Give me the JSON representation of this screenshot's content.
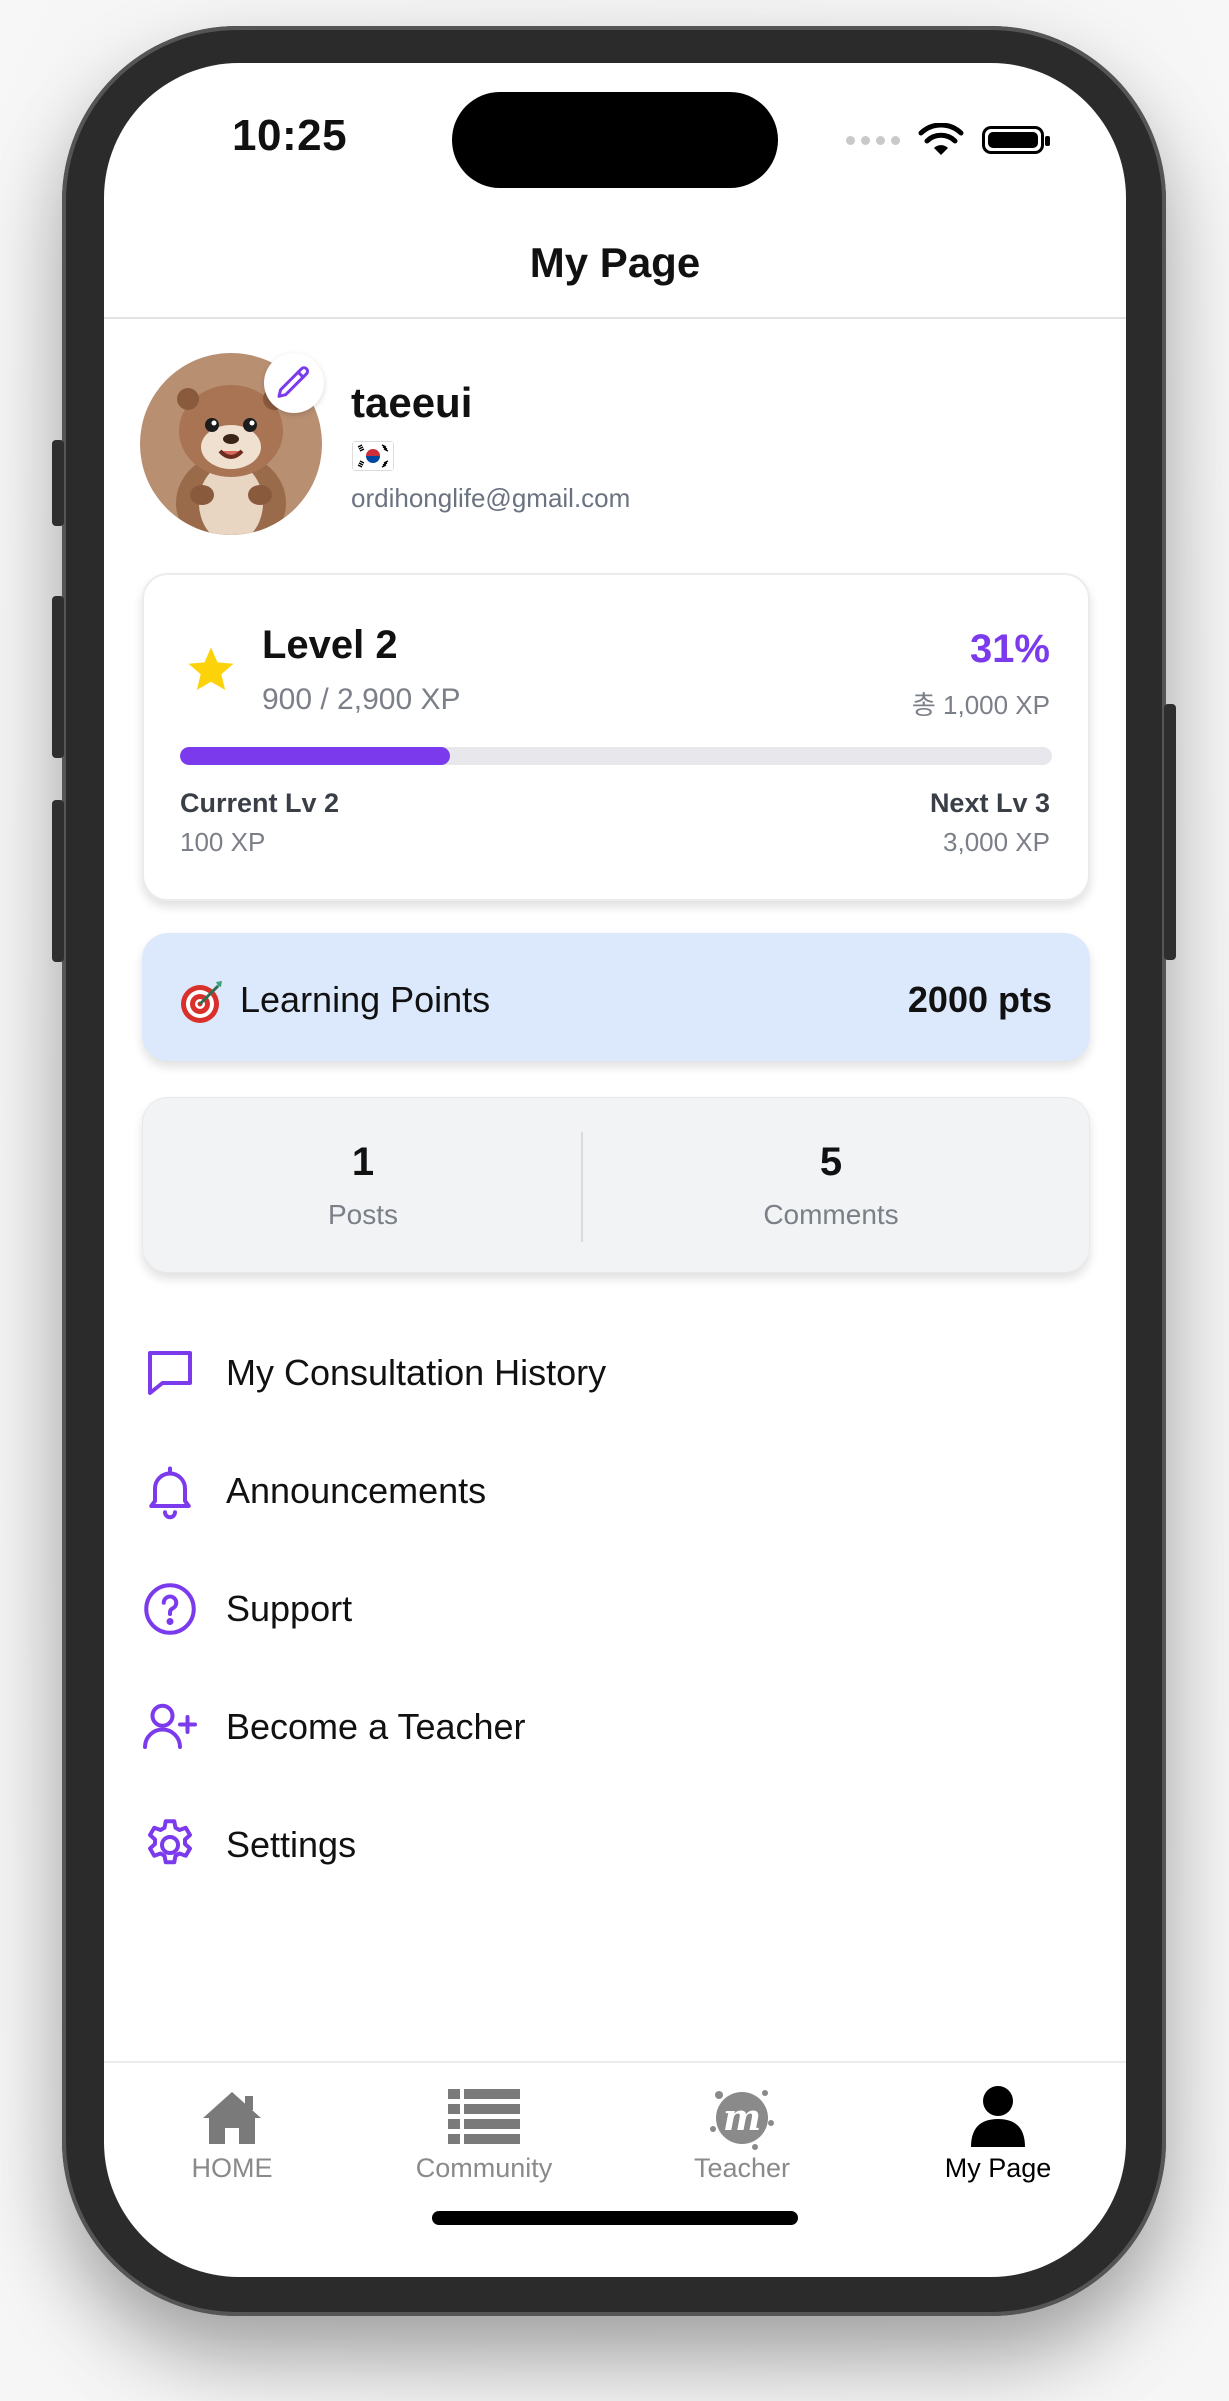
{
  "status_bar": {
    "time": "10:25"
  },
  "header": {
    "title": "My Page"
  },
  "profile": {
    "username": "taeeui",
    "flag": "korea-flag-icon",
    "email": "ordihonglife@gmail.com"
  },
  "level": {
    "title": "Level 2",
    "xp_text": "900 / 2,900 XP",
    "percent_text": "31%",
    "progress": 0.31,
    "total_xp": "총 1,000 XP",
    "current_label": "Current Lv 2",
    "current_xp": "100 XP",
    "next_label": "Next Lv 3",
    "next_xp": "3,000 XP",
    "accent": "#7c3aed"
  },
  "points": {
    "label": "Learning Points",
    "value": "2000 pts"
  },
  "stats": {
    "posts_count": "1",
    "posts_label": "Posts",
    "comments_count": "5",
    "comments_label": "Comments"
  },
  "menu": [
    {
      "label": "My Consultation History",
      "icon": "chat-bubble-icon"
    },
    {
      "label": "Announcements",
      "icon": "bell-icon"
    },
    {
      "label": "Support",
      "icon": "question-circle-icon"
    },
    {
      "label": "Become a Teacher",
      "icon": "user-plus-icon"
    },
    {
      "label": "Settings",
      "icon": "gear-icon"
    }
  ],
  "tabs": [
    {
      "label": "HOME",
      "icon": "home-icon"
    },
    {
      "label": "Community",
      "icon": "list-icon"
    },
    {
      "label": "Teacher",
      "icon": "teacher-logo-icon"
    },
    {
      "label": "My Page",
      "icon": "person-icon",
      "active": true
    }
  ]
}
